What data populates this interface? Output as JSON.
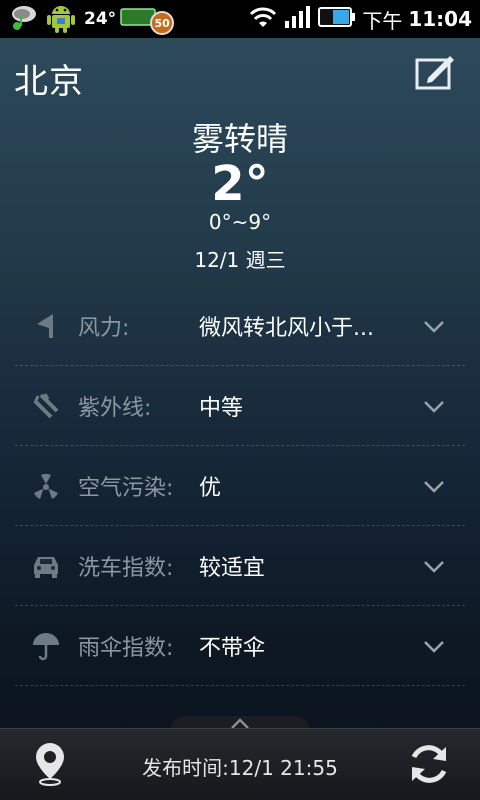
{
  "status_bar": {
    "temperature": "24°",
    "battery_badge": "50",
    "time_prefix": "下午",
    "time": "11:04"
  },
  "header": {
    "city": "北京"
  },
  "current": {
    "condition": "雾转晴",
    "temperature": "2°",
    "range": "0°~9°",
    "date": "12/1 週三"
  },
  "details": [
    {
      "icon": "flag-icon",
      "label": "风力:",
      "value": "微风转北风小于..."
    },
    {
      "icon": "uv-icon",
      "label": "紫外线:",
      "value": "中等"
    },
    {
      "icon": "radiation-icon",
      "label": "空气污染:",
      "value": "优"
    },
    {
      "icon": "car-icon",
      "label": "洗车指数:",
      "value": "较适宜"
    },
    {
      "icon": "umbrella-icon",
      "label": "雨伞指数:",
      "value": "不带伞"
    }
  ],
  "footer": {
    "publish_time": "发布时间:12/1 21:55"
  }
}
